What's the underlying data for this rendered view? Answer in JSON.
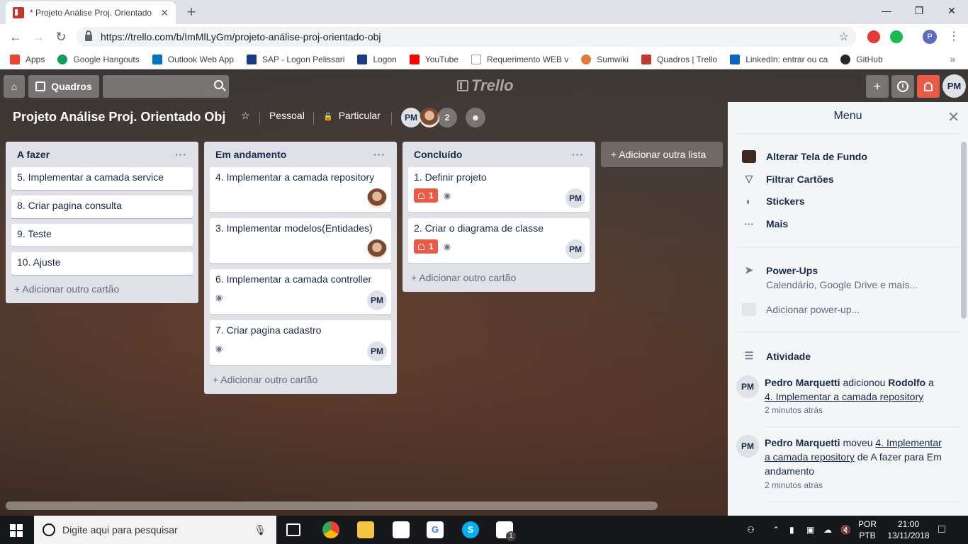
{
  "browser": {
    "tab_title": "* Projeto Análise Proj. Orientado",
    "tab_close": "✕",
    "new_tab": "+",
    "url": "https://trello.com/b/ImMlLyGm/projeto-análise-proj-orientado-obj",
    "profile_initial": "P",
    "bookmarks": [
      {
        "label": "Apps",
        "color": "#ea4335"
      },
      {
        "label": "Google Hangouts",
        "color": "#0f9d58"
      },
      {
        "label": "Outlook Web App",
        "color": "#0072c6"
      },
      {
        "label": "SAP - Logon Pelissari",
        "color": "#1a3a8a"
      },
      {
        "label": "Logon",
        "color": "#1a3a8a"
      },
      {
        "label": "YouTube",
        "color": "#ff0000"
      },
      {
        "label": "Requerimento WEB v",
        "color": "#9aa0a6"
      },
      {
        "label": "Sumwiki",
        "color": "#e07b39"
      },
      {
        "label": "Quadros | Trello",
        "color": "#c0392b"
      },
      {
        "label": "LinkedIn: entrar ou ca",
        "color": "#0a66c2"
      },
      {
        "label": "GitHub",
        "color": "#24292e"
      }
    ],
    "bookmarks_more": "»"
  },
  "trello": {
    "boards_button": "Quadros",
    "logo": "Trello",
    "user_initials": "PM",
    "board_title": "Projeto Análise Proj. Orientado Obj",
    "team": "Pessoal",
    "visibility": "Particular",
    "members": [
      "PM"
    ],
    "member_extra_count": "2",
    "add_list": "+ Adicionar outra lista",
    "lists": [
      {
        "title": "A fazer",
        "add_card": "+ Adicionar outro cartão",
        "cards": [
          {
            "title": "5. Implementar a camada service"
          },
          {
            "title": "8. Criar pagina consulta"
          },
          {
            "title": "9. Teste"
          },
          {
            "title": "10. Ajuste"
          }
        ]
      },
      {
        "title": "Em andamento",
        "add_card": "+ Adicionar outro cartão",
        "cards": [
          {
            "title": "4. Implementar a camada repository"
          },
          {
            "title": "3. Implementar modelos(Entidades)"
          },
          {
            "title": "6. Implementar a camada controller",
            "member": "PM"
          },
          {
            "title": "7. Criar pagina cadastro",
            "member": "PM"
          }
        ]
      },
      {
        "title": "Concluído",
        "add_card": "+ Adicionar outro cartão",
        "cards": [
          {
            "title": "1. Definir projeto",
            "notifications": "1",
            "member": "PM"
          },
          {
            "title": "2. Criar o diagrama de classe",
            "notifications": "1",
            "member": "PM"
          }
        ]
      }
    ],
    "menu": {
      "title": "Menu",
      "close": "✕",
      "items": [
        {
          "label": "Alterar Tela de Fundo"
        },
        {
          "label": "Filtrar Cartões"
        },
        {
          "label": "Stickers"
        },
        {
          "label": "Mais"
        }
      ],
      "powerups_title": "Power-Ups",
      "powerups_sub": "Calendário, Google Drive e mais...",
      "add_powerup": "Adicionar power-up...",
      "activity_title": "Atividade",
      "activities": [
        {
          "avatar": "PM",
          "user": "Pedro Marquetti",
          "verb": " adicionou ",
          "target": "Rodolfo",
          "prep": " a ",
          "card": "4. Implementar a camada repository",
          "time": "2 minutos atrás"
        },
        {
          "avatar": "PM",
          "user": "Pedro Marquetti",
          "verb": " moveu ",
          "card": "4. Implementar a camada repository",
          "rest": " de A fazer para Em andamento",
          "time": "2 minutos atrás"
        }
      ]
    }
  },
  "taskbar": {
    "search_placeholder": "Digite aqui para pesquisar",
    "lang_top": "POR",
    "lang_bottom": "PTB",
    "time": "21:00",
    "date": "13/11/2018",
    "mail_badge": "1"
  }
}
